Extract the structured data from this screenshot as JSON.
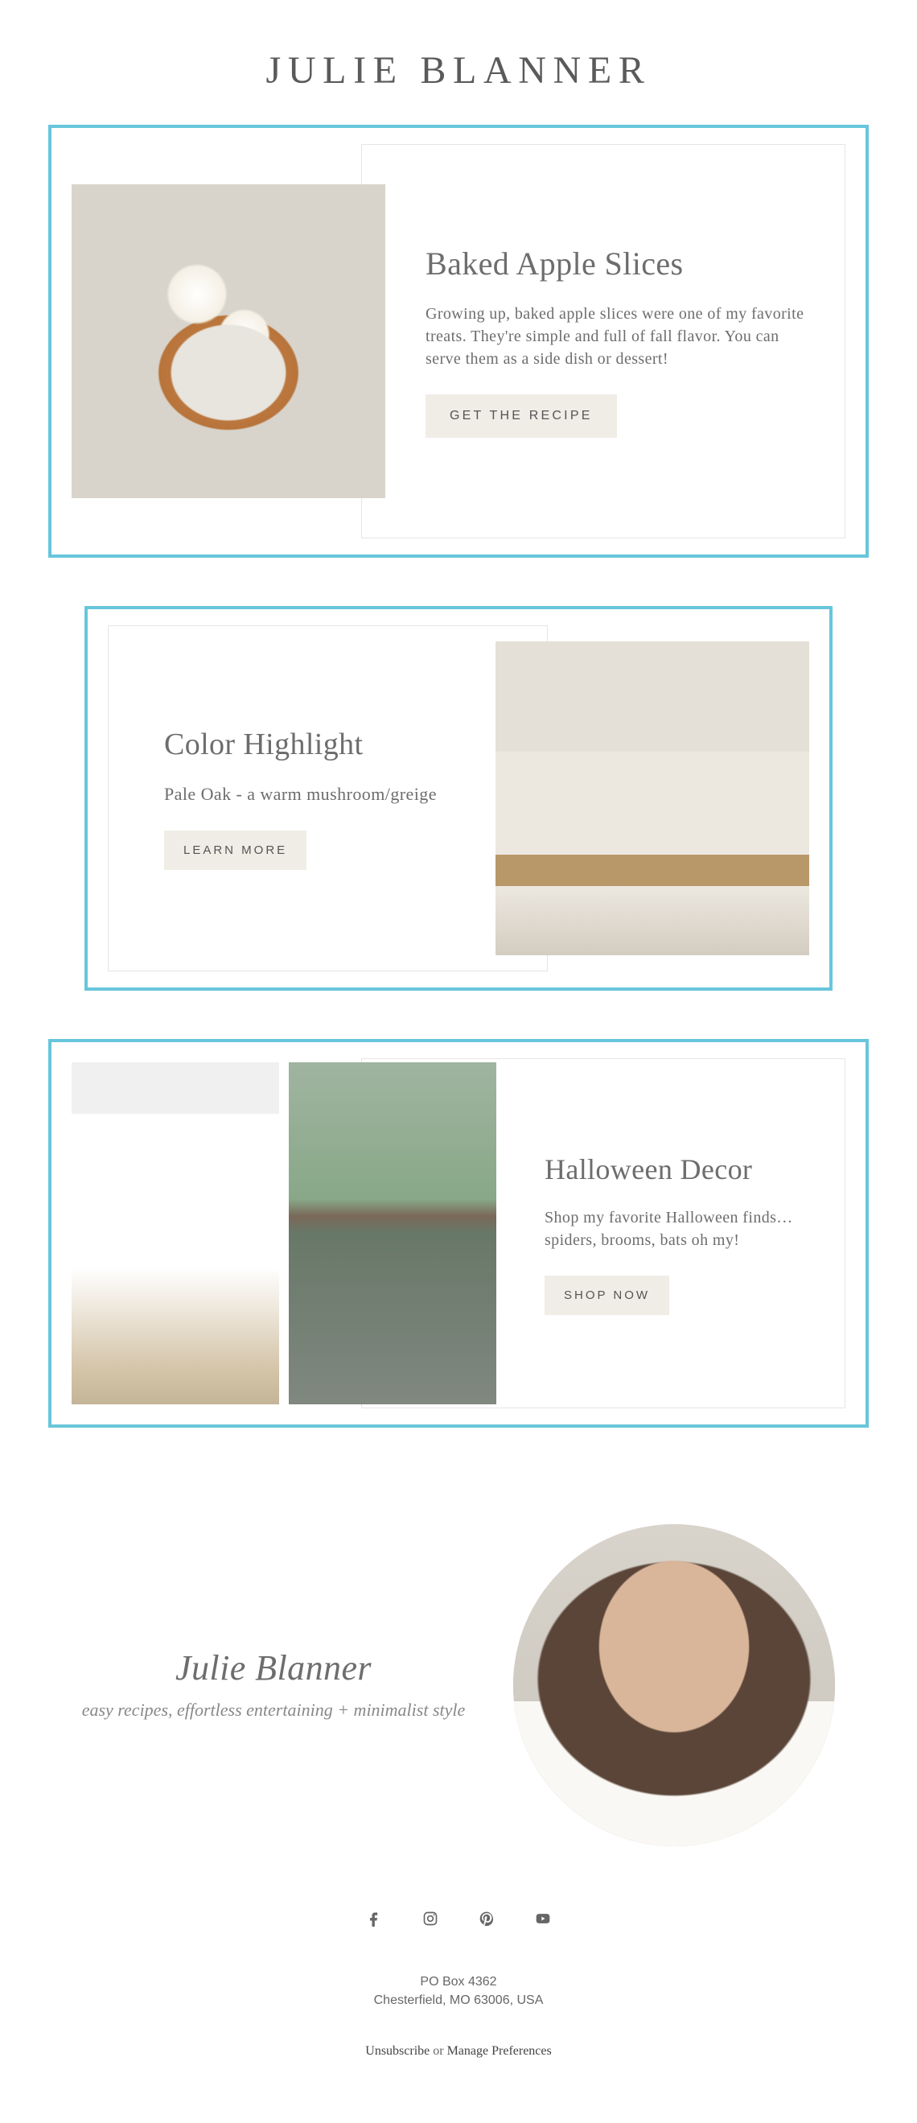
{
  "header": {
    "logo": "JULIE BLANNER"
  },
  "cards": [
    {
      "title": "Baked Apple Slices",
      "desc": "Growing up, baked apple slices were one of my favorite treats. They're simple and full of fall flavor. You can serve them as a side dish or dessert!",
      "button": "GET THE RECIPE"
    },
    {
      "title": "Color Highlight",
      "desc": "Pale Oak - a warm mushroom/greige",
      "button": "LEARN MORE"
    },
    {
      "title": "Halloween Decor",
      "desc": "Shop my favorite Halloween finds… spiders, brooms, bats oh my!",
      "button": "SHOP NOW"
    }
  ],
  "bio": {
    "name": "Julie Blanner",
    "tagline": "easy recipes, effortless entertaining + minimalist style"
  },
  "footer": {
    "line1": "PO Box 4362",
    "line2": "Chesterfield, MO 63006, USA",
    "unsubscribe": "Unsubscribe",
    "or": " or ",
    "manage": "Manage Preferences"
  }
}
